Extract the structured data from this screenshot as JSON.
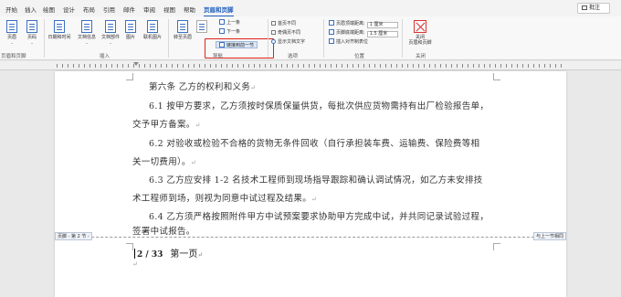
{
  "tabs": [
    "开始",
    "插入",
    "绘图",
    "设计",
    "布局",
    "引用",
    "邮件",
    "审阅",
    "视图",
    "帮助",
    "页眉和页脚"
  ],
  "active_tab_index": 10,
  "comment_button": "批注",
  "ribbon": {
    "header_footer_group": {
      "header": "页眉",
      "footer": "页码",
      "label": "页眉和页脚"
    },
    "insert_group": {
      "date_time": "日期和时间",
      "doc_info": "文档信息",
      "doc_parts": "文档部件",
      "picture": "图片",
      "online_picture": "联机图片",
      "label": "插入"
    },
    "nav_group": {
      "goto_header": "转至页眉",
      "goto_footer": "转至页脚",
      "previous": "上一条",
      "next": "下一条",
      "link_previous": "链接到前一节",
      "label": "导航"
    },
    "options_group": {
      "diff_first": "首页不同",
      "diff_odd_even": "奇偶页不同",
      "show_text": "显示文档文字",
      "label": "选项"
    },
    "position_group": {
      "header_top_label": "页眉顶端距离:",
      "header_top_value": "1 厘米",
      "footer_bottom_label": "页脚底端距离:",
      "footer_bottom_value": "1.5 厘米",
      "insert_align_tab": "插入对齐制表位",
      "label": "位置"
    },
    "close_group": {
      "close_button": "关闭\n页眉和页脚",
      "close_line1": "关闭",
      "close_line2": "页眉和页脚",
      "label": "关闭"
    }
  },
  "document": {
    "heading": "第六条  乙方的权利和义务",
    "p1_line1": "6.1   按甲方要求，乙方须按时保质保量供货，每批次供应货物需持有出厂检验报告单，",
    "p1_line2": "交予甲方备案。",
    "p2_line1": "6.2   对验收或检验不合格的货物无条件回收（自行承担装车费、运输费、保险费等相",
    "p2_line2": "关一切费用）。",
    "p3_line1": "6.3   乙方应安排 1-2 名技术工程师到现场指导跟踪和确认调试情况，如乙方未安排技",
    "p3_line2": "术工程师到场，则视为同意中试过程及结果。",
    "p4_line1": "6.4   乙方须严格按照附件甲方中试预案要求协助甲方完成中试，并共同记录试验过程，",
    "p4_line2": "签署中试报告。",
    "para_mark": "↵",
    "footer_tag": "页脚 - 第 2 节 -",
    "same_as_prev": "与上一节相同",
    "page_number": "2 / 33",
    "page_label": "第一页"
  }
}
